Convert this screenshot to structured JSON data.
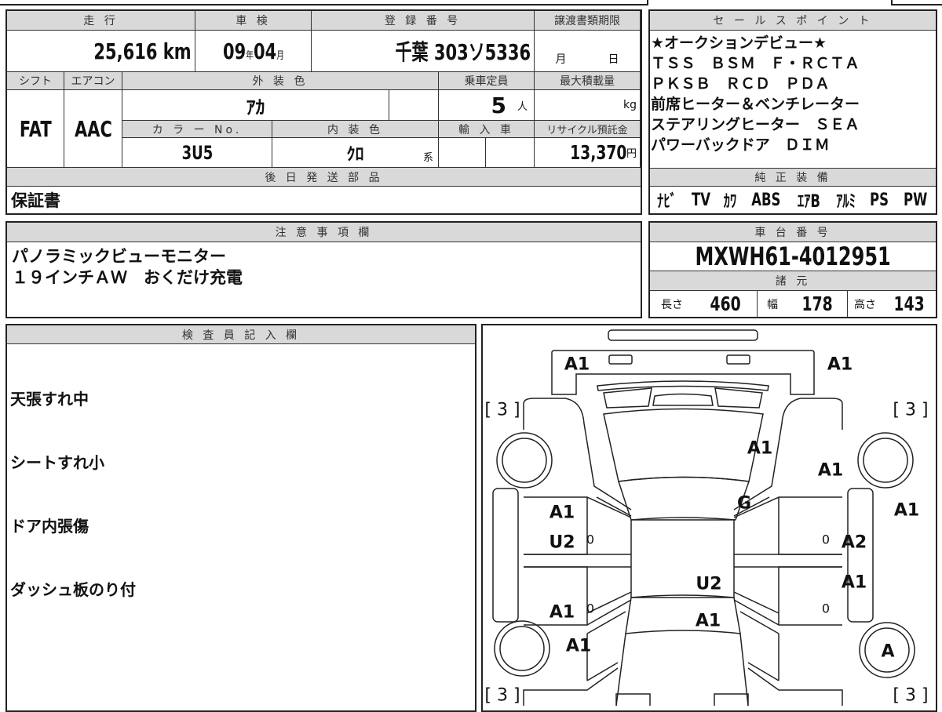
{
  "main_table": {
    "headers": {
      "mileage": "走 行",
      "inspection": "車 検",
      "registration": "登 録 番 号",
      "transfer_deadline": "譲渡書類期限",
      "shift": "シフト",
      "aircon": "エアコン",
      "exterior_color": "外 装 色",
      "capacity": "乗車定員",
      "max_load": "最大積載量",
      "color_no": "カ ラ ー No.",
      "interior_color": "内 装 色",
      "import": "輸 入 車",
      "recycle_fee": "リサイクル預託金",
      "later_parts": "後 日 発 送 部 品"
    },
    "mileage": "25,616",
    "mileage_unit": "km",
    "inspection_year": "09",
    "year_unit": "年",
    "inspection_month": "04",
    "month_unit": "月",
    "registration": "千葉 303ソ5336",
    "deadline_month": "月",
    "deadline_day": "日",
    "shift": "FAT",
    "aircon": "AAC",
    "exterior_color": "ｱｶ",
    "capacity": "5",
    "capacity_unit": "人",
    "max_load_unit": "kg",
    "color_no": "3U5",
    "interior_color": "ｸﾛ",
    "interior_suffix": "系",
    "recycle_fee": "13,370",
    "yen": "円",
    "later_parts": "保証書"
  },
  "sale_points": {
    "header": "セ ー ル ス ポ イ ン ト",
    "lines": [
      "★オークションデビュー★",
      "ＴＳＳ　ＢＳＭ　Ｆ・ＲＣＴＡ",
      "ＰＫＳＢ　ＲＣＤ　ＰＤＡ",
      "前席ヒーター＆ベンチレーター",
      "ステアリングヒーター　ＳＥＡ",
      "パワーバックドア　ＤＩＭ"
    ]
  },
  "equipment": {
    "header": "純 正 装 備",
    "items": [
      "ﾅﾋﾞ",
      "TV",
      "ｶﾜ",
      "ABS",
      "ｴｱB",
      "ｱﾙﾐ",
      "PS",
      "PW"
    ]
  },
  "notes": {
    "header": "注 意 事 項 欄",
    "lines": [
      "パノラミックビューモニター",
      "１９インチＡＷ　おくだけ充電"
    ]
  },
  "chassis": {
    "header": "車 台 番 号",
    "value": "MXWH61-4012951"
  },
  "specs": {
    "header": "諸 元",
    "length_label": "長さ",
    "length": "460",
    "width_label": "幅",
    "width": "178",
    "height_label": "高さ",
    "height": "143"
  },
  "inspector": {
    "header": "検 査 員 記 入 欄",
    "lines": [
      "天張すれ中",
      "シートすれ小",
      "ドア内張傷",
      "ダッシュ板のり付"
    ]
  },
  "diagram": {
    "tire_marks": [
      "[ 3 ]",
      "[ 3 ]",
      "[ 3 ]",
      "[ 3 ]"
    ],
    "marks": [
      "A1",
      "A1",
      "A1",
      "A1",
      "G",
      "A1",
      "A1",
      "U2",
      "0",
      "0",
      "A2",
      "U2",
      "A1",
      "A1",
      "0",
      "0",
      "A1",
      "A1",
      "A"
    ]
  }
}
